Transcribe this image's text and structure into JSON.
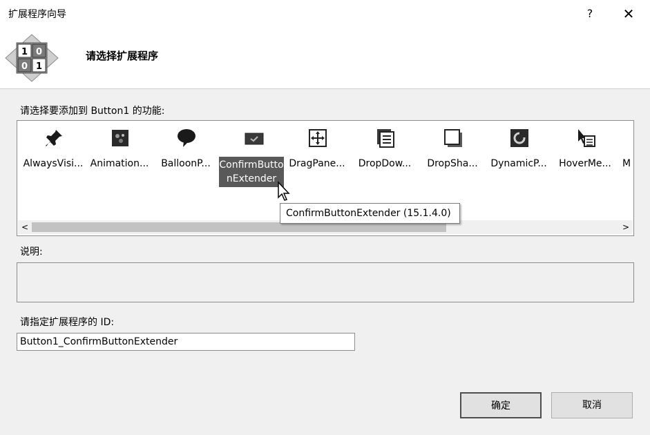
{
  "window": {
    "title": "扩展程序向导",
    "help_label": "?",
    "close_label": "✕"
  },
  "header": {
    "title": "请选择扩展程序",
    "icon": "binary-grid-icon",
    "icon_digits": [
      "1",
      "0",
      "0",
      "1"
    ]
  },
  "extensions": {
    "label": "请选择要添加到 Button1 的功能:",
    "items": [
      {
        "name": "AlwaysVisi...",
        "icon": "pin-icon"
      },
      {
        "name": "Animation...",
        "icon": "animation-icon"
      },
      {
        "name": "BalloonP...",
        "icon": "speech-balloon-icon"
      },
      {
        "name": "ConfirmButtonExtender",
        "icon": "confirm-button-icon",
        "selected": true
      },
      {
        "name": "DragPane...",
        "icon": "drag-panel-icon"
      },
      {
        "name": "DropDow...",
        "icon": "dropdown-icon"
      },
      {
        "name": "DropSha...",
        "icon": "drop-shadow-icon"
      },
      {
        "name": "DynamicP...",
        "icon": "dynamic-populate-icon"
      },
      {
        "name": "HoverMe...",
        "icon": "hover-menu-icon"
      },
      {
        "name": "M",
        "icon": "more-icon"
      }
    ],
    "tooltip": "ConfirmButtonExtender (15.1.4.0)",
    "scroll_left": "<",
    "scroll_right": ">"
  },
  "description": {
    "label": "说明:",
    "value": ""
  },
  "extender_id": {
    "label": "请指定扩展程序的 ID:",
    "value": "Button1_ConfirmButtonExtender"
  },
  "buttons": {
    "ok_label": "确定",
    "cancel_label": "取消"
  },
  "colors": {
    "selection": "#595959",
    "background": "#f0f0f0"
  }
}
